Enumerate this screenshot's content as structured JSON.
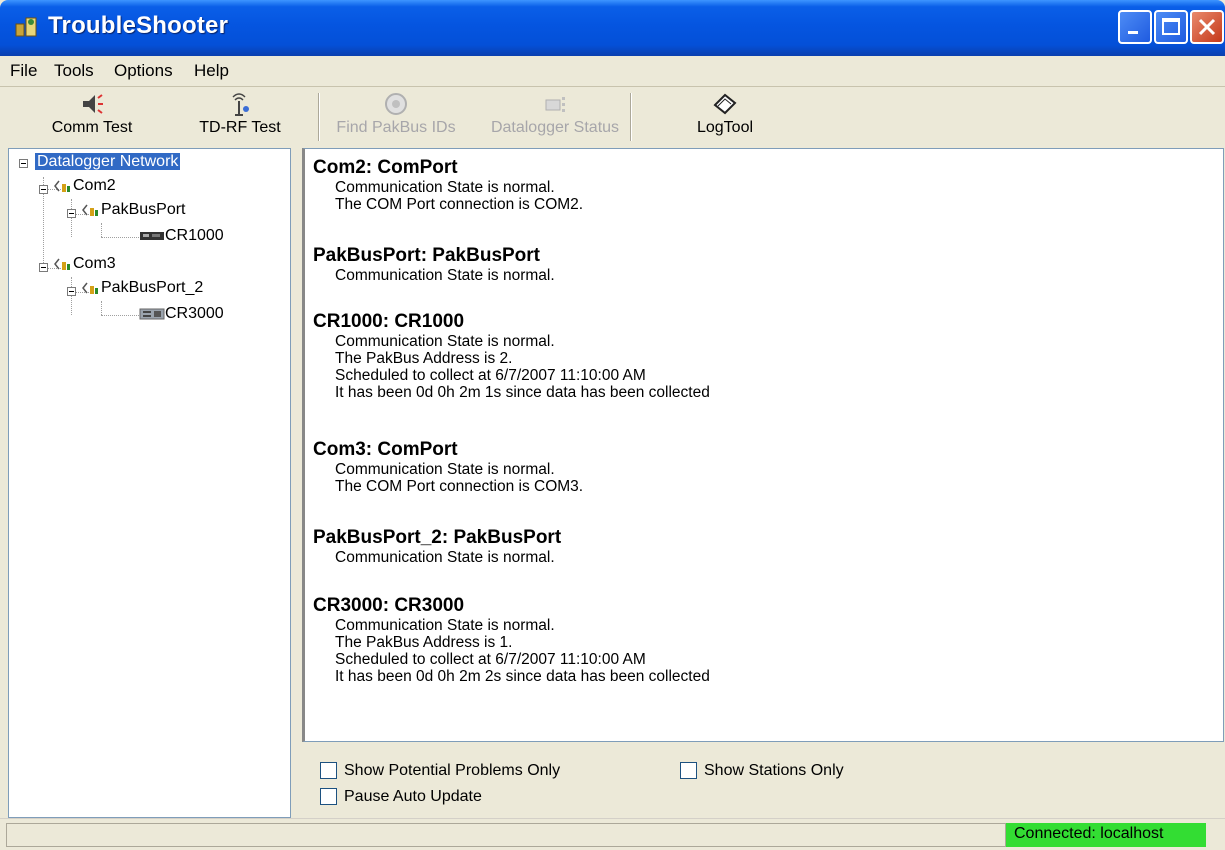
{
  "window": {
    "title": "TroubleShooter",
    "accent": "#0555e0"
  },
  "menu": [
    "File",
    "Tools",
    "Options",
    "Help"
  ],
  "toolbar": {
    "comm_test": "Comm Test",
    "tdrf_test": "TD-RF Test",
    "find_pakbus": "Find PakBus IDs",
    "datalogger_status": "Datalogger Status",
    "logtool": "LogTool"
  },
  "tree": {
    "root": "Datalogger Network",
    "com2": "Com2",
    "pakbusport": "PakBusPort",
    "cr1000": "CR1000",
    "com3": "Com3",
    "pakbusport2": "PakBusPort_2",
    "cr3000": "CR3000"
  },
  "details": [
    {
      "heading": "Com2: ComPort",
      "lines": [
        "Communication State is normal.",
        "The COM Port connection is COM2."
      ]
    },
    {
      "heading": "PakBusPort: PakBusPort",
      "lines": [
        "Communication State is normal."
      ]
    },
    {
      "heading": "CR1000: CR1000",
      "lines": [
        "Communication State is normal.",
        "The PakBus Address is 2.",
        "Scheduled to collect at 6/7/2007 11:10:00 AM",
        "It has been 0d 0h 2m 1s since data has been collected"
      ]
    },
    {
      "heading": "Com3: ComPort",
      "lines": [
        "Communication State is normal.",
        "The COM Port connection is COM3."
      ]
    },
    {
      "heading": "PakBusPort_2: PakBusPort",
      "lines": [
        "Communication State is normal."
      ]
    },
    {
      "heading": "CR3000: CR3000",
      "lines": [
        "Communication State is normal.",
        "The PakBus Address is 1.",
        "Scheduled to collect at 6/7/2007 11:10:00 AM",
        "It has been 0d 0h 2m 2s since data has been collected"
      ]
    }
  ],
  "options": {
    "show_problems": "Show Potential Problems Only",
    "show_stations": "Show Stations Only",
    "pause_update": "Pause Auto Update"
  },
  "status": {
    "connection": "Connected: localhost",
    "connection_color": "#33dd33"
  }
}
